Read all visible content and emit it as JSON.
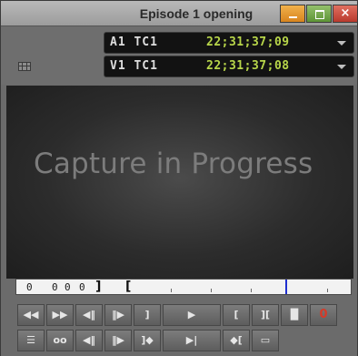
{
  "window": {
    "title": "Episode 1 opening",
    "buttons": {
      "minimize_icon": "minimize-icon",
      "maximize_icon": "maximize-icon",
      "close_icon": "close-icon",
      "close_glyph": "×"
    },
    "colors": {
      "minimize": "#e49a34",
      "maximize": "#78aa4f",
      "close": "#c94a3c"
    }
  },
  "timecode": {
    "rows": [
      {
        "label": "A1 TC1",
        "value": "22;31;37;09",
        "dropdown_icon": "chevron-down-icon"
      },
      {
        "label": "V1 TC1",
        "value": "22;31;37;08",
        "dropdown_icon": "chevron-down-icon"
      }
    ],
    "value_color": "#b8d64a"
  },
  "viewer": {
    "message": "Capture in Progress",
    "grid_icon": "grid-icon"
  },
  "timeline": {
    "markers": [
      "0",
      "0",
      "0",
      "0"
    ],
    "mark_out": "]",
    "mark_in": "[",
    "position_color": "#1f2fcf"
  },
  "transport": {
    "row1": [
      {
        "name": "rewind-button",
        "glyph": "◀◀"
      },
      {
        "name": "fast-forward-button",
        "glyph": "▶▶"
      },
      {
        "name": "step-back-button",
        "glyph": "◀‖"
      },
      {
        "name": "step-forward-button",
        "glyph": "‖▶"
      },
      {
        "name": "mark-out-button",
        "glyph": "]"
      },
      {
        "name": "play-button",
        "glyph": "▶"
      },
      {
        "name": "mark-in-button",
        "glyph": "["
      },
      {
        "name": "mark-clip-button",
        "glyph": "]["
      },
      {
        "name": "clear-marks-button",
        "glyph": "▐▌"
      },
      {
        "name": "record-button",
        "glyph": "0"
      }
    ],
    "row2": [
      {
        "name": "clip-list-button",
        "glyph": "☰"
      },
      {
        "name": "tape-button",
        "glyph": "oo"
      },
      {
        "name": "frame-back-button",
        "glyph": "◀‖"
      },
      {
        "name": "frame-forward-button",
        "glyph": "‖▶"
      },
      {
        "name": "go-to-out-button",
        "glyph": "]◆"
      },
      {
        "name": "go-to-end-button",
        "glyph": "▶|"
      },
      {
        "name": "go-to-in-button",
        "glyph": "◆["
      },
      {
        "name": "film-button",
        "glyph": "▭"
      }
    ]
  }
}
